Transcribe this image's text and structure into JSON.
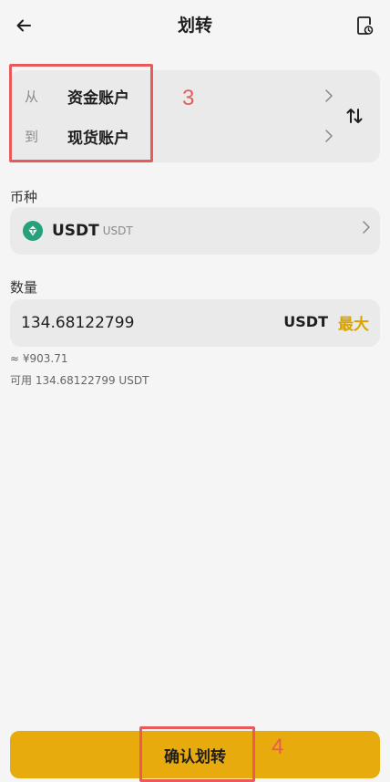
{
  "header": {
    "title": "划转"
  },
  "accounts": {
    "from_prefix": "从",
    "from_account": "资金账户",
    "to_prefix": "到",
    "to_account": "现货账户"
  },
  "coin": {
    "label": "币种",
    "symbol": "USDT",
    "sub": "USDT"
  },
  "amount": {
    "label": "数量",
    "value": "134.68122799",
    "unit": "USDT",
    "max_label": "最大",
    "approx_value": "≈ ¥903.71",
    "available": "可用 134.68122799 USDT"
  },
  "confirm_label": "确认划转",
  "annotations": {
    "accounts_num": "3",
    "confirm_num": "4",
    "color": "#e95b5b"
  },
  "colors": {
    "accent": "#e8ab0e",
    "max_text": "#d9a400",
    "coin_icon": "#26a17b"
  }
}
